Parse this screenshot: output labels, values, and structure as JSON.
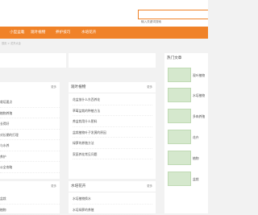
{
  "search": {
    "placeholder": "输入关键词搜索"
  },
  "nav": {
    "items": [
      "小型盆栽",
      "观叶植物",
      "养护技巧",
      "水培花卉"
    ]
  },
  "breadcrumb": "首页 > 花卉大全",
  "left_card_top": {
    "more": "更多",
    "items": [
      "吊兰",
      "植物",
      "",
      "",
      "",
      ""
    ]
  },
  "left_card_top_items_visible": [
    "植物养殖",
    "",
    "对长期",
    "",
    "与水养",
    "时间",
    "分全攻略"
  ],
  "left_col": {
    "top": {
      "more": "更多",
      "items": [
        "栽培要点",
        "植物养殖",
        "长得好",
        "对长期的打理",
        "与水养",
        "养护",
        "公全攻略"
      ]
    },
    "bottom": {
      "more": "更多",
      "items": [
        "盆栽",
        "植物"
      ]
    }
  },
  "middle_top": {
    "title": "观叶植物",
    "more": "更多",
    "items": [
      "花盆放什么东西养花",
      "草莓盆栽的种植方法",
      "养盆栽用什么肥料",
      "盆栽植物叶子发黄的原因",
      "绿萝的养殖方法",
      "家庭养花常见问题"
    ]
  },
  "middle_bottom": {
    "title": "水培花卉",
    "more": "更多",
    "items": [
      "水培植物换水",
      "水培绿萝的养殖"
    ]
  },
  "hot": {
    "title": "热门文章",
    "items": [
      "观叶植物",
      "水培植物",
      "多肉养殖",
      "花卉",
      "植物",
      "盆栽"
    ]
  }
}
